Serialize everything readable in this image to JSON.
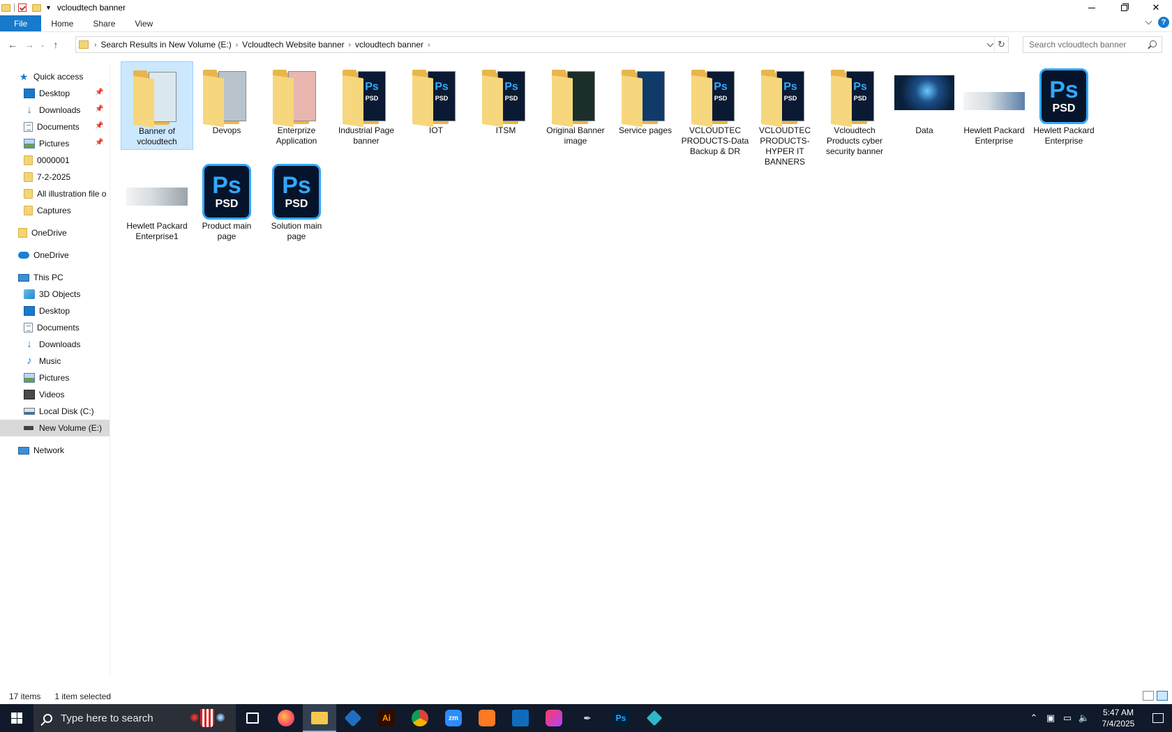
{
  "window": {
    "title": "vcloudtech banner"
  },
  "ribbon": {
    "tabs": [
      {
        "label": "File"
      },
      {
        "label": "Home"
      },
      {
        "label": "Share"
      },
      {
        "label": "View"
      }
    ],
    "help": "?"
  },
  "address": {
    "crumbs": [
      "Search Results in New Volume (E:)",
      "Vcloudtech Website banner",
      "vcloudtech banner"
    ]
  },
  "search": {
    "placeholder": "Search vcloudtech banner"
  },
  "nav": {
    "quick_access": "Quick access",
    "quick_items": [
      {
        "label": "Desktop"
      },
      {
        "label": "Downloads"
      },
      {
        "label": "Documents"
      },
      {
        "label": "Pictures"
      },
      {
        "label": "0000001"
      },
      {
        "label": "7-2-2025"
      },
      {
        "label": "All illustration file o"
      },
      {
        "label": "Captures"
      }
    ],
    "onedrive_personal": "OneDrive",
    "onedrive": "OneDrive",
    "this_pc": "This PC",
    "pc_items": [
      {
        "label": "3D Objects"
      },
      {
        "label": "Desktop"
      },
      {
        "label": "Documents"
      },
      {
        "label": "Downloads"
      },
      {
        "label": "Music"
      },
      {
        "label": "Pictures"
      },
      {
        "label": "Videos"
      },
      {
        "label": "Local Disk (C:)"
      },
      {
        "label": "New Volume (E:)"
      }
    ],
    "network": "Network"
  },
  "items": [
    {
      "name": "Banner of vcloudtech",
      "kind": "folder",
      "doc_color": "#dce8f0"
    },
    {
      "name": "Devops",
      "kind": "folder",
      "doc_color": "#b9c3cc"
    },
    {
      "name": "Enterprize Application",
      "kind": "folder",
      "doc_color": "#e9b6b0"
    },
    {
      "name": "Industrial Page banner",
      "kind": "folder-psd",
      "doc_color": "#0b1a33"
    },
    {
      "name": "IOT",
      "kind": "folder-psd",
      "doc_color": "#0b1a33"
    },
    {
      "name": "ITSM",
      "kind": "folder-psd",
      "doc_color": "#0b1a33"
    },
    {
      "name": "Original Banner image",
      "kind": "folder",
      "doc_color": "#1c2e2a"
    },
    {
      "name": "Service pages",
      "kind": "folder",
      "doc_color": "#0f3a6a"
    },
    {
      "name": "VCLOUDTEC PRODUCTS-Data Backup & DR",
      "kind": "folder-psd",
      "doc_color": "#0b1a33"
    },
    {
      "name": "VCLOUDTEC PRODUCTS-HYPER IT BANNERS",
      "kind": "folder-psd",
      "doc_color": "#0b1a33"
    },
    {
      "name": "Vcloudtech Products cyber security banner",
      "kind": "folder-psd",
      "doc_color": "#0b1a33"
    },
    {
      "name": "Data",
      "kind": "image",
      "doc_color": "#0a1f3a"
    },
    {
      "name": "Hewlett Packard Enterprise",
      "kind": "image-wide",
      "doc_color": "#5a7fa8"
    },
    {
      "name": "Hewlett Packard Enterprise",
      "kind": "psd"
    },
    {
      "name": "Hewlett Packard Enterprise1",
      "kind": "image-wide",
      "doc_color": "#9aa3aa"
    },
    {
      "name": "Product main page",
      "kind": "psd"
    },
    {
      "name": "Solution main page",
      "kind": "psd"
    }
  ],
  "psd_icon": {
    "ps": "Ps",
    "ext": "PSD"
  },
  "folder_psd_glyph": {
    "ps": "Ps",
    "ext": "PSD"
  },
  "status": {
    "count": "17 items",
    "selected": "1 item selected"
  },
  "taskbar": {
    "search_placeholder": "Type here to search",
    "apps": [
      {
        "name": "task-view",
        "label": ""
      },
      {
        "name": "firefox",
        "label": ""
      },
      {
        "name": "file-explorer",
        "label": ""
      },
      {
        "name": "vscode",
        "label": ""
      },
      {
        "name": "illustrator",
        "label": "Ai"
      },
      {
        "name": "chrome",
        "label": ""
      },
      {
        "name": "zoom",
        "label": "zm"
      },
      {
        "name": "xampp",
        "label": ""
      },
      {
        "name": "outlook",
        "label": ""
      },
      {
        "name": "creative-cloud",
        "label": ""
      },
      {
        "name": "pen-tool",
        "label": ""
      },
      {
        "name": "photoshop",
        "label": "Ps"
      },
      {
        "name": "app-diamond",
        "label": ""
      }
    ],
    "time": "5:47 AM",
    "date": "7/4/2025"
  }
}
